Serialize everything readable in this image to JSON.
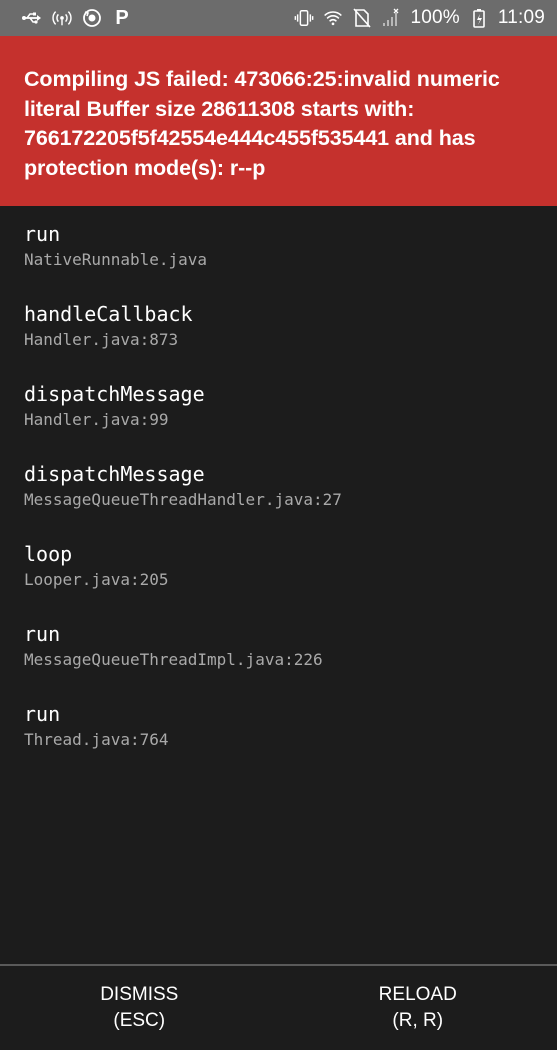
{
  "status_bar": {
    "battery_text": "100%",
    "time": "11:09",
    "left_icons": [
      "usb-icon",
      "wifi-hotspot-icon",
      "sync-icon",
      "parking-p-icon"
    ],
    "right_icons": [
      "vibrate-icon",
      "wifi-icon",
      "no-sim-icon",
      "cell-signal-icon",
      "battery-charging-icon"
    ],
    "p_glyph": "P"
  },
  "error": {
    "message": "Compiling JS failed: 473066:25:invalid numeric literal Buffer size 28611308 starts with: 766172205f5f42554e444c455f535441 and has protection mode(s): r--p",
    "background_color": "#c5312d"
  },
  "stack": [
    {
      "method": "run",
      "location": "NativeRunnable.java"
    },
    {
      "method": "handleCallback",
      "location": "Handler.java:873"
    },
    {
      "method": "dispatchMessage",
      "location": "Handler.java:99"
    },
    {
      "method": "dispatchMessage",
      "location": "MessageQueueThreadHandler.java:27"
    },
    {
      "method": "loop",
      "location": "Looper.java:205"
    },
    {
      "method": "run",
      "location": "MessageQueueThreadImpl.java:226"
    },
    {
      "method": "run",
      "location": "Thread.java:764"
    }
  ],
  "footer": {
    "dismiss_label": "DISMISS",
    "dismiss_shortcut": "(ESC)",
    "reload_label": "RELOAD",
    "reload_shortcut": "(R, R)"
  }
}
